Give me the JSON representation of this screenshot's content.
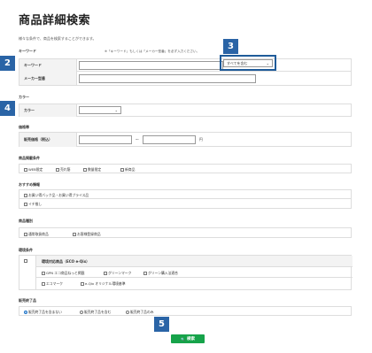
{
  "page": {
    "title": "商品詳細検索",
    "intro": "様々な条件で、商品を検索することができます。"
  },
  "keyword_section": {
    "heading": "キーワード",
    "note": "※「キーワード」もしくは「メーカー型番」を必ず入力ください。",
    "keyword_label": "キーワード",
    "keyword_value": "",
    "match_select": "すべてを含む",
    "maker_label": "メーカー型番",
    "maker_value": ""
  },
  "color_section": {
    "heading": "カラー",
    "label": "カラー",
    "select": ""
  },
  "price_section": {
    "heading": "価格帯",
    "label": "販売価格（税込）",
    "separator": "～",
    "unit": "円",
    "min": "",
    "max": ""
  },
  "condition_section": {
    "heading": "商品掲載条件",
    "options": [
      "WEB限定",
      "売れ筋",
      "数量限定",
      "新商品"
    ]
  },
  "recommend_section": {
    "heading": "おすすめ情報",
    "options": [
      "お買い得パック品・お買い得プライス品",
      "イチ推し"
    ]
  },
  "type_section": {
    "heading": "商品種別",
    "options": [
      "通常取扱商品",
      "お客様登録商品"
    ]
  },
  "env_section": {
    "heading": "環境条件",
    "group_label": "環境対応商品（ECO e-Qix）",
    "options": [
      "GPN エコ商品ねっと掲載",
      "グリーンマーク",
      "グリーン購入法適合",
      "エコマーク",
      "e-Qix オリジナル環境基準"
    ]
  },
  "discontinued_section": {
    "heading": "販売終了品",
    "options": [
      "販売終了品を含まない",
      "販売終了品を含む",
      "販売終了品のみ"
    ],
    "selected": 0
  },
  "search_button": {
    "label": "検索"
  },
  "badges": {
    "b2": "2",
    "b3": "3",
    "b4": "4",
    "b5": "5"
  }
}
